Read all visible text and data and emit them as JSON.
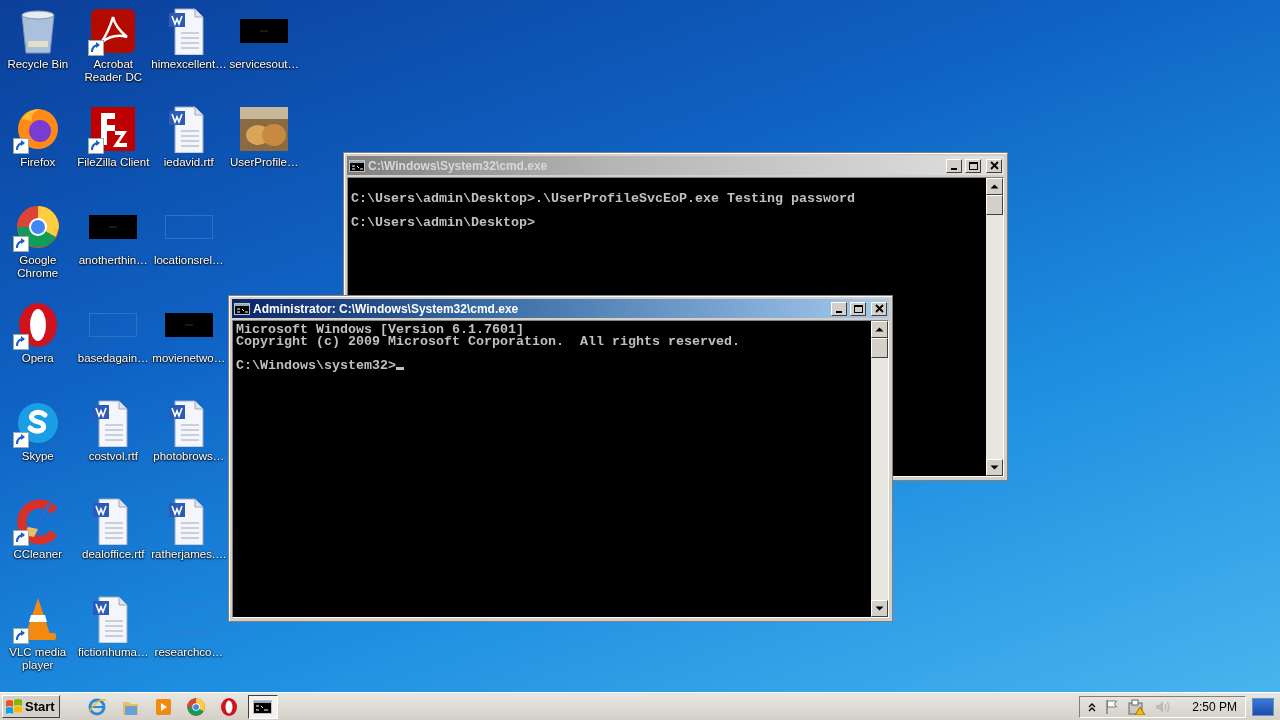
{
  "desktop": {
    "icons": [
      {
        "label": "Recycle Bin",
        "kind": "recycle",
        "shortcut": false
      },
      {
        "label": "Firefox",
        "kind": "firefox",
        "shortcut": true
      },
      {
        "label": "Google Chrome",
        "kind": "chrome",
        "shortcut": true
      },
      {
        "label": "Opera",
        "kind": "opera",
        "shortcut": true
      },
      {
        "label": "Skype",
        "kind": "skype",
        "shortcut": true
      },
      {
        "label": "CCleaner",
        "kind": "ccleaner",
        "shortcut": true
      },
      {
        "label": "VLC media player",
        "kind": "vlc",
        "shortcut": true
      },
      {
        "label": "Acrobat Reader DC",
        "kind": "acrobat",
        "shortcut": true
      },
      {
        "label": "FileZilla Client",
        "kind": "filezilla",
        "shortcut": true
      },
      {
        "label": "anotherthin…",
        "kind": "dark",
        "shortcut": false
      },
      {
        "label": "basedagain…",
        "kind": "blank",
        "shortcut": false
      },
      {
        "label": "costvol.rtf",
        "kind": "word",
        "shortcut": false
      },
      {
        "label": "dealoffice.rtf",
        "kind": "word",
        "shortcut": false
      },
      {
        "label": "fictionhuma…",
        "kind": "word",
        "shortcut": false
      },
      {
        "label": "himexcellent…",
        "kind": "word",
        "shortcut": false
      },
      {
        "label": "iedavid.rtf",
        "kind": "word",
        "shortcut": false
      },
      {
        "label": "locationsrel…",
        "kind": "blank",
        "shortcut": false
      },
      {
        "label": "movienetwo…",
        "kind": "dark",
        "shortcut": false
      },
      {
        "label": "photobrows…",
        "kind": "word",
        "shortcut": false
      },
      {
        "label": "ratherjames.…",
        "kind": "word",
        "shortcut": false
      },
      {
        "label": "researchco…",
        "kind": "blank",
        "shortcut": false
      },
      {
        "label": "servicesout…",
        "kind": "dark",
        "shortcut": false
      },
      {
        "label": "UserProfile…",
        "kind": "photo",
        "shortcut": false
      }
    ]
  },
  "windows": [
    {
      "title": "C:\\Windows\\System32\\cmd.exe",
      "active": false,
      "cursor": false,
      "lines": [
        {
          "text": "C:\\Users\\admin\\Desktop>.\\UserProfileSvcEoP.exe Testing password",
          "spaced": true
        },
        {
          "text": "C:\\Users\\admin\\Desktop>",
          "spaced": true
        }
      ]
    },
    {
      "title": "Administrator: C:\\Windows\\System32\\cmd.exe",
      "active": true,
      "cursor": true,
      "lines": [
        {
          "text": "Microsoft Windows [Version 6.1.7601]",
          "spaced": false
        },
        {
          "text": "Copyright (c) 2009 Microsoft Corporation.  All rights reserved.",
          "spaced": false
        },
        {
          "text": "C:\\Windows\\system32>",
          "spaced": true
        }
      ]
    }
  ],
  "taskbar": {
    "start": "Start",
    "items": [
      {
        "kind": "ie",
        "selected": false
      },
      {
        "kind": "folder",
        "selected": false
      },
      {
        "kind": "media",
        "selected": false
      },
      {
        "kind": "chrome",
        "selected": false
      },
      {
        "kind": "opera",
        "selected": false
      },
      {
        "kind": "console",
        "selected": true
      }
    ],
    "clock": "2:50 PM"
  }
}
